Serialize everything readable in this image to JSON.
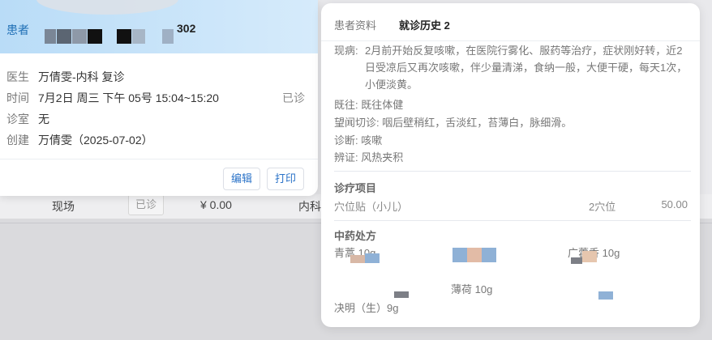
{
  "background_row": {
    "source": "现场",
    "status_tag": "已诊",
    "amount": "¥ 0.00",
    "dept": "内科"
  },
  "appointment": {
    "patient_label": "患者",
    "patient_name_suffix": "302",
    "doctor_label": "医生",
    "doctor_value": "万倩雯-内科 复诊",
    "time_label": "时间",
    "time_value": "7月2日 周三 下午 05号 15:04~15:20",
    "status": "已诊",
    "room_label": "诊室",
    "room_value": "无",
    "created_label": "创建",
    "created_value": "万倩雯（2025-07-02）",
    "edit_button": "编辑",
    "print_button": "打印"
  },
  "detail": {
    "tab_profile": "患者资料",
    "tab_history": "就诊历史 2",
    "present_illness_label": "现病:",
    "present_illness_text": "2月前开始反复咳嗽，在医院行雾化、服药等治疗，症状刚好转，近2日受凉后又再次咳嗽，伴少量清涕，食纳一般，大便干硬，每天1次，小便淡黄。",
    "past_history": "既往: 既往体健",
    "inspection": "望闻切诊: 咽后壁稍红，舌淡红，苔薄白，脉细滑。",
    "diagnosis": "诊断: 咳嗽",
    "syndrome": "辨证: 风热夹积",
    "treatment_title": "诊疗项目",
    "treatment_items": [
      {
        "name": "穴位贴（小儿）",
        "qty": "2穴位",
        "amount": "50.00"
      }
    ],
    "herbal_title": "中药处方",
    "herbs": {
      "h1": "青蒿 10g",
      "h2": "广藿香 10g",
      "h3": "薄荷 10g",
      "h4": "决明（生）9g"
    }
  },
  "colors": {
    "header_blue": "#b9dcf7",
    "accent": "#2b73c8",
    "label_blue": "#1f6fb5"
  }
}
